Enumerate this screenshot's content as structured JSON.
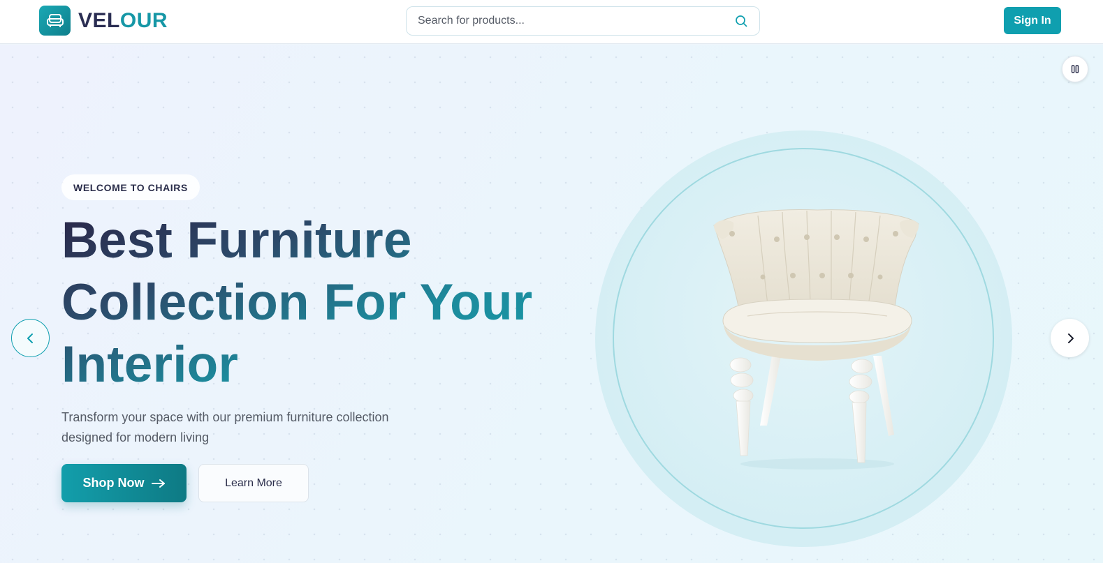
{
  "header": {
    "logo_part1": "VEL",
    "logo_part2": "OUR",
    "search_placeholder": "Search for products...",
    "signin_label": "Sign In"
  },
  "hero": {
    "badge": "WELCOME TO CHAIRS",
    "headline_lines": [
      "Best Furniture",
      "Collection For Your",
      "Interior"
    ],
    "description": "Transform your space with our premium furniture collection designed for modern living",
    "shop_label": "Shop Now",
    "learn_label": "Learn More"
  },
  "icons": {
    "logo": "sofa-icon",
    "search": "search-icon",
    "pause": "pause-icon",
    "prev": "chevron-left-icon",
    "next": "chevron-right-icon",
    "shop": "arrow-right-icon"
  },
  "colors": {
    "accent": "#0f9faf",
    "dark": "#2a2d52"
  }
}
